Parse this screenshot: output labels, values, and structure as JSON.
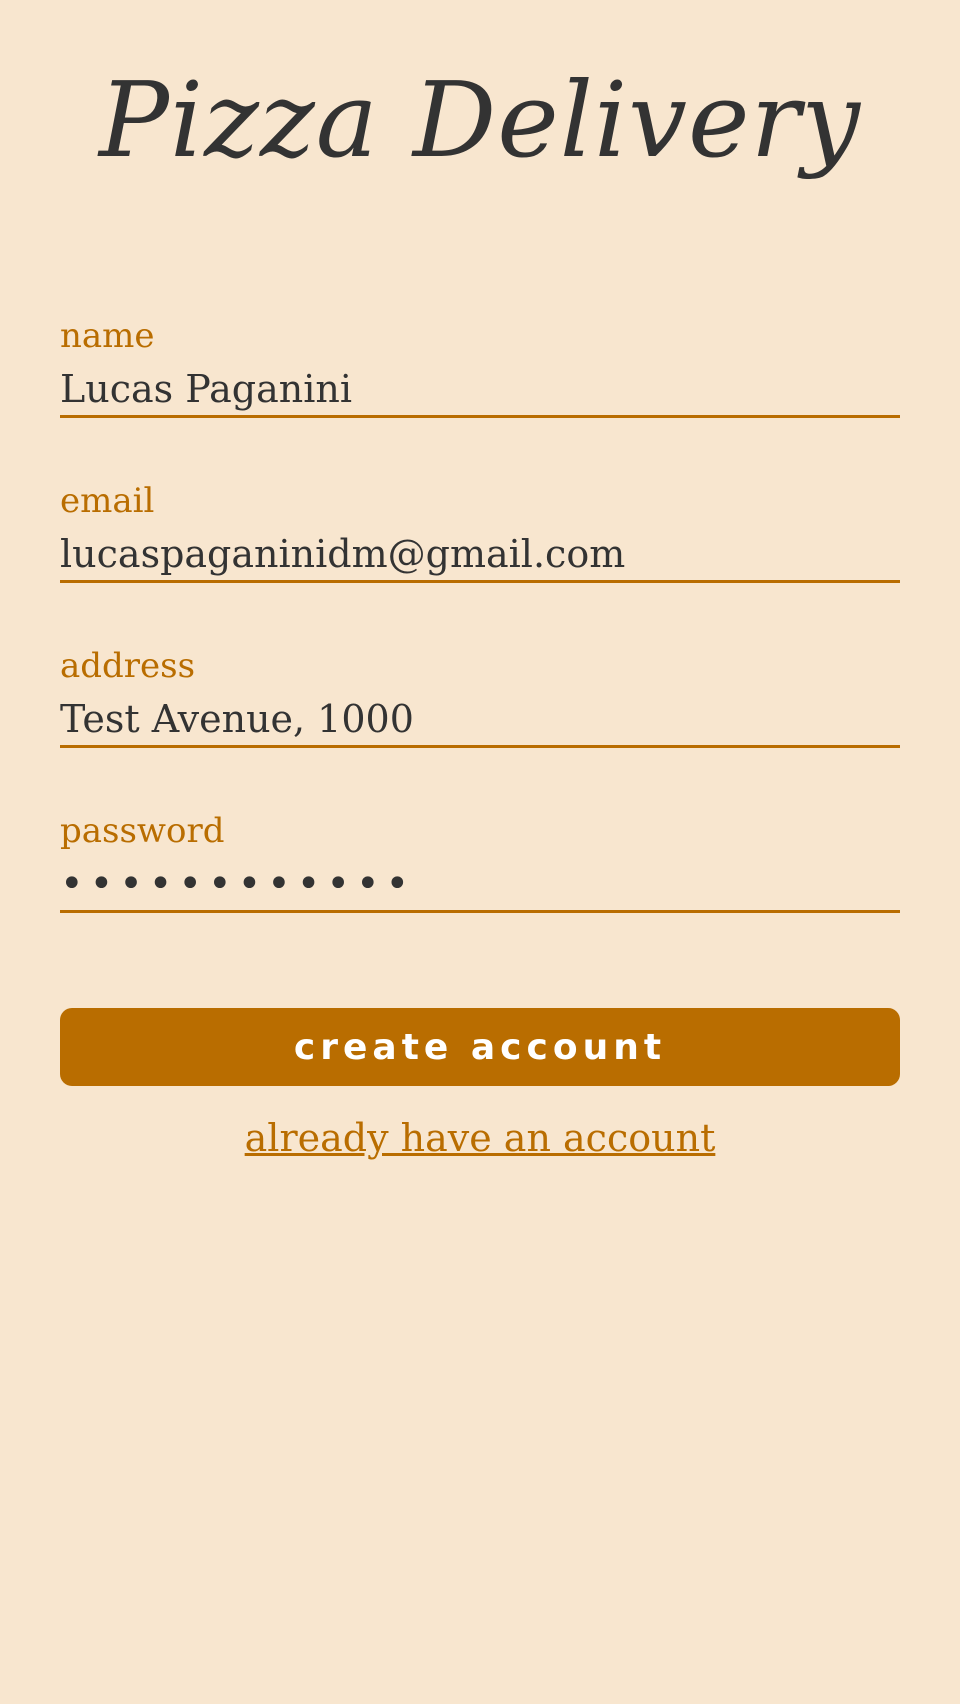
{
  "app": {
    "title": "Pizza Delivery"
  },
  "form": {
    "fields": [
      {
        "label": "name",
        "value": "Lucas Paganini",
        "type": "text"
      },
      {
        "label": "email",
        "value": "lucaspaganinidm@gmail.com",
        "type": "email"
      },
      {
        "label": "address",
        "value": "Test Avenue, 1000",
        "type": "text"
      },
      {
        "label": "password",
        "value": "xxxxxxxxxxxx",
        "type": "password"
      }
    ],
    "submit_label": "create account",
    "login_link_label": "already have an account"
  },
  "colors": {
    "background": "#f8e6cf",
    "accent": "#b96d00",
    "text": "#333333",
    "button_text": "#ffffff"
  }
}
